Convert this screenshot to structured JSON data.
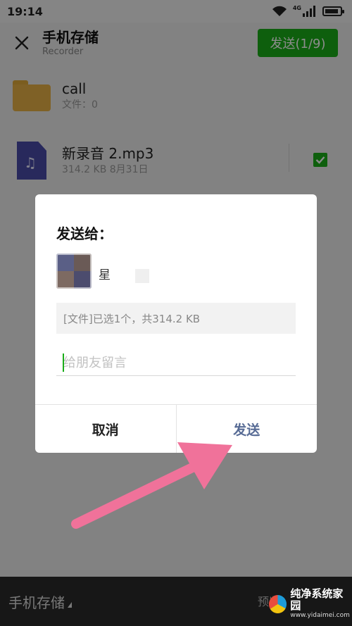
{
  "status_bar": {
    "time": "19:14",
    "network_tag": "4G",
    "icons": [
      "wifi-icon",
      "signal-icon",
      "battery-icon"
    ]
  },
  "header": {
    "title": "手机存储",
    "subtitle": "Recorder",
    "send_label": "发送(1/9)",
    "close_icon": "close-icon"
  },
  "files": [
    {
      "name": "call",
      "meta": "文件：0",
      "icon": "folder-icon"
    },
    {
      "name": "新录音 2.mp3",
      "meta": "314.2 KB   8月31日",
      "icon": "music-file-icon",
      "checked": true
    }
  ],
  "bottom_bar": {
    "location": "手机存储",
    "preview": "预览"
  },
  "dialog": {
    "title": "发送给：",
    "recipient_name": "星",
    "file_info": "[文件]已选1个，共314.2 KB",
    "message_placeholder": "给朋友留言",
    "cancel_label": "取消",
    "send_label": "发送"
  },
  "watermark": {
    "text": "纯净系统家园",
    "url": "www.yidaimei.com"
  },
  "colors": {
    "accent_green": "#1aad19",
    "link_blue": "#576b95",
    "annotation_pink": "#f0729a"
  }
}
